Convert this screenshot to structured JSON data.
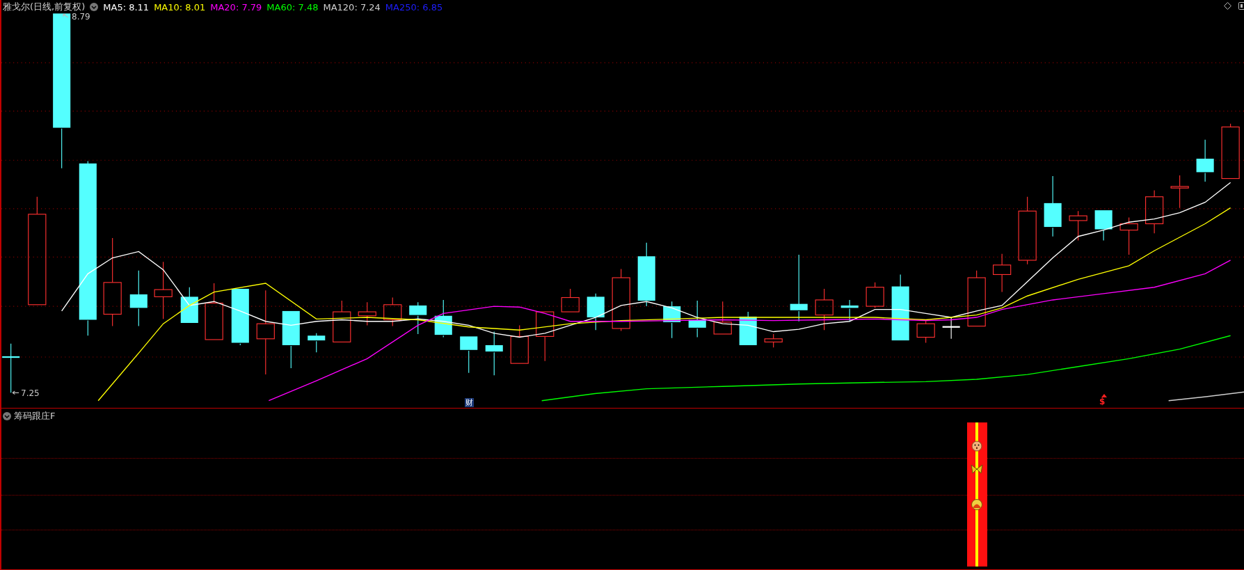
{
  "chart": {
    "title": "雅戈尔(日线,前复权)",
    "moving_averages": [
      {
        "label": "MA5: 8.11",
        "color": "#ffffff"
      },
      {
        "label": "MA10: 8.01",
        "color": "#ffff00"
      },
      {
        "label": "MA20: 7.79",
        "color": "#ff00ff"
      },
      {
        "label": "MA60: 7.48",
        "color": "#00ff00"
      },
      {
        "label": "MA120: 7.24",
        "color": "#d0d0d0"
      },
      {
        "label": "MA250: 6.85",
        "color": "#1e1eff"
      }
    ],
    "high_label": "8.79",
    "low_label": "7.25",
    "markers": [
      {
        "kind": "finance",
        "text": "财"
      },
      {
        "kind": "dividend",
        "text": "$"
      }
    ]
  },
  "indicator": {
    "title": "筹码跟庄F"
  }
}
